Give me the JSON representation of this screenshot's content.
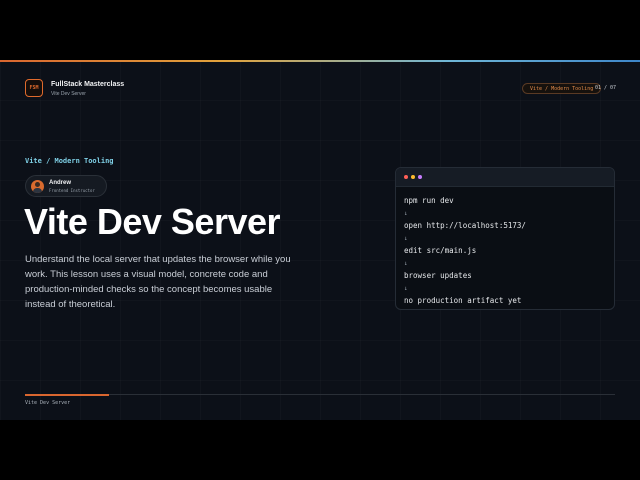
{
  "header": {
    "logo_text": "FSM",
    "brand_title": "FullStack Masterclass",
    "brand_subtitle": "Vite Dev Server",
    "section_pill": "Vite / Modern Tooling",
    "pager": "01 / 07"
  },
  "hero": {
    "kicker": "Vite / Modern Tooling",
    "author_name": "Andrew",
    "author_role": "Frontend Instructor",
    "title": "Vite Dev Server",
    "description": "Understand the local server that updates the browser while you work. This lesson uses a visual model, concrete code and production-minded checks so the concept becomes usable instead of theoretical."
  },
  "terminal": {
    "lines": [
      "npm run dev",
      "↓",
      "open http://localhost:5173/",
      "↓",
      "edit src/main.js",
      "↓",
      "browser updates",
      "↓",
      "no production artifact yet"
    ]
  },
  "footer": {
    "label": "Vite Dev Server",
    "progress": 0.143
  },
  "colors": {
    "accent": "#d9662f",
    "kicker": "#7fd0e6",
    "background": "#0c1018"
  }
}
